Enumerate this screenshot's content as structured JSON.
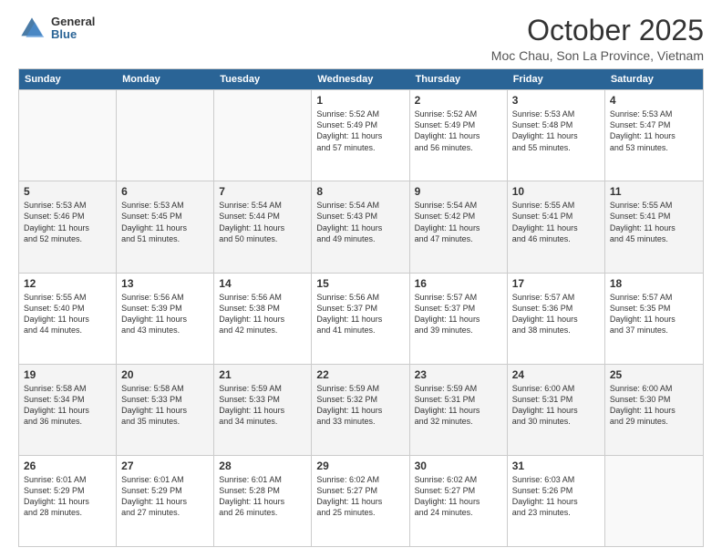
{
  "logo": {
    "general": "General",
    "blue": "Blue"
  },
  "header": {
    "month": "October 2025",
    "location": "Moc Chau, Son La Province, Vietnam"
  },
  "days": [
    "Sunday",
    "Monday",
    "Tuesday",
    "Wednesday",
    "Thursday",
    "Friday",
    "Saturday"
  ],
  "rows": [
    [
      {
        "day": "",
        "info": ""
      },
      {
        "day": "",
        "info": ""
      },
      {
        "day": "",
        "info": ""
      },
      {
        "day": "1",
        "info": "Sunrise: 5:52 AM\nSunset: 5:49 PM\nDaylight: 11 hours\nand 57 minutes."
      },
      {
        "day": "2",
        "info": "Sunrise: 5:52 AM\nSunset: 5:49 PM\nDaylight: 11 hours\nand 56 minutes."
      },
      {
        "day": "3",
        "info": "Sunrise: 5:53 AM\nSunset: 5:48 PM\nDaylight: 11 hours\nand 55 minutes."
      },
      {
        "day": "4",
        "info": "Sunrise: 5:53 AM\nSunset: 5:47 PM\nDaylight: 11 hours\nand 53 minutes."
      }
    ],
    [
      {
        "day": "5",
        "info": "Sunrise: 5:53 AM\nSunset: 5:46 PM\nDaylight: 11 hours\nand 52 minutes."
      },
      {
        "day": "6",
        "info": "Sunrise: 5:53 AM\nSunset: 5:45 PM\nDaylight: 11 hours\nand 51 minutes."
      },
      {
        "day": "7",
        "info": "Sunrise: 5:54 AM\nSunset: 5:44 PM\nDaylight: 11 hours\nand 50 minutes."
      },
      {
        "day": "8",
        "info": "Sunrise: 5:54 AM\nSunset: 5:43 PM\nDaylight: 11 hours\nand 49 minutes."
      },
      {
        "day": "9",
        "info": "Sunrise: 5:54 AM\nSunset: 5:42 PM\nDaylight: 11 hours\nand 47 minutes."
      },
      {
        "day": "10",
        "info": "Sunrise: 5:55 AM\nSunset: 5:41 PM\nDaylight: 11 hours\nand 46 minutes."
      },
      {
        "day": "11",
        "info": "Sunrise: 5:55 AM\nSunset: 5:41 PM\nDaylight: 11 hours\nand 45 minutes."
      }
    ],
    [
      {
        "day": "12",
        "info": "Sunrise: 5:55 AM\nSunset: 5:40 PM\nDaylight: 11 hours\nand 44 minutes."
      },
      {
        "day": "13",
        "info": "Sunrise: 5:56 AM\nSunset: 5:39 PM\nDaylight: 11 hours\nand 43 minutes."
      },
      {
        "day": "14",
        "info": "Sunrise: 5:56 AM\nSunset: 5:38 PM\nDaylight: 11 hours\nand 42 minutes."
      },
      {
        "day": "15",
        "info": "Sunrise: 5:56 AM\nSunset: 5:37 PM\nDaylight: 11 hours\nand 41 minutes."
      },
      {
        "day": "16",
        "info": "Sunrise: 5:57 AM\nSunset: 5:37 PM\nDaylight: 11 hours\nand 39 minutes."
      },
      {
        "day": "17",
        "info": "Sunrise: 5:57 AM\nSunset: 5:36 PM\nDaylight: 11 hours\nand 38 minutes."
      },
      {
        "day": "18",
        "info": "Sunrise: 5:57 AM\nSunset: 5:35 PM\nDaylight: 11 hours\nand 37 minutes."
      }
    ],
    [
      {
        "day": "19",
        "info": "Sunrise: 5:58 AM\nSunset: 5:34 PM\nDaylight: 11 hours\nand 36 minutes."
      },
      {
        "day": "20",
        "info": "Sunrise: 5:58 AM\nSunset: 5:33 PM\nDaylight: 11 hours\nand 35 minutes."
      },
      {
        "day": "21",
        "info": "Sunrise: 5:59 AM\nSunset: 5:33 PM\nDaylight: 11 hours\nand 34 minutes."
      },
      {
        "day": "22",
        "info": "Sunrise: 5:59 AM\nSunset: 5:32 PM\nDaylight: 11 hours\nand 33 minutes."
      },
      {
        "day": "23",
        "info": "Sunrise: 5:59 AM\nSunset: 5:31 PM\nDaylight: 11 hours\nand 32 minutes."
      },
      {
        "day": "24",
        "info": "Sunrise: 6:00 AM\nSunset: 5:31 PM\nDaylight: 11 hours\nand 30 minutes."
      },
      {
        "day": "25",
        "info": "Sunrise: 6:00 AM\nSunset: 5:30 PM\nDaylight: 11 hours\nand 29 minutes."
      }
    ],
    [
      {
        "day": "26",
        "info": "Sunrise: 6:01 AM\nSunset: 5:29 PM\nDaylight: 11 hours\nand 28 minutes."
      },
      {
        "day": "27",
        "info": "Sunrise: 6:01 AM\nSunset: 5:29 PM\nDaylight: 11 hours\nand 27 minutes."
      },
      {
        "day": "28",
        "info": "Sunrise: 6:01 AM\nSunset: 5:28 PM\nDaylight: 11 hours\nand 26 minutes."
      },
      {
        "day": "29",
        "info": "Sunrise: 6:02 AM\nSunset: 5:27 PM\nDaylight: 11 hours\nand 25 minutes."
      },
      {
        "day": "30",
        "info": "Sunrise: 6:02 AM\nSunset: 5:27 PM\nDaylight: 11 hours\nand 24 minutes."
      },
      {
        "day": "31",
        "info": "Sunrise: 6:03 AM\nSunset: 5:26 PM\nDaylight: 11 hours\nand 23 minutes."
      },
      {
        "day": "",
        "info": ""
      }
    ]
  ]
}
